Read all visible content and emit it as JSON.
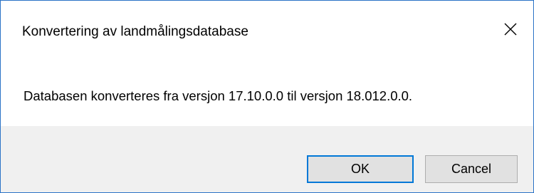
{
  "window": {
    "title": "Konvertering av landmålingsdatabase",
    "close_icon": "close-icon"
  },
  "message": {
    "text": "Databasen konverteres fra versjon 17.10.0.0 til versjon 18.012.0.0."
  },
  "buttons": {
    "ok_label": "OK",
    "cancel_label": "Cancel"
  },
  "colors": {
    "window_border": "#2b73c7",
    "footer_background": "#f0f0f0",
    "default_button_border": "#0078d7"
  }
}
